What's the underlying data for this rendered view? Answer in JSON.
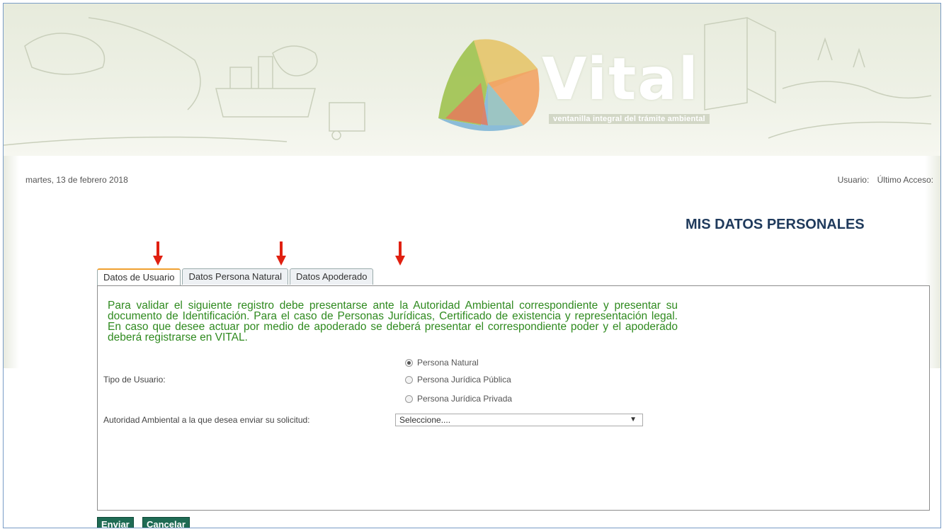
{
  "header": {
    "brand_name": "Vital",
    "brand_subtitle": "ventanilla integral del trámite ambiental"
  },
  "info": {
    "date": "martes, 13 de febrero 2018",
    "user_label": "Usuario:",
    "last_access_label": "Último Acceso:"
  },
  "page_title": "MIS DATOS PERSONALES",
  "tabs": [
    {
      "label": "Datos de Usuario",
      "active": true
    },
    {
      "label": "Datos Persona Natural",
      "active": false
    },
    {
      "label": "Datos Apoderado",
      "active": false
    }
  ],
  "form": {
    "notice": "Para validar el siguiente registro debe presentarse ante la Autoridad Ambiental correspondiente y presentar su documento de Identificación. Para el caso de Personas Jurídicas, Certificado de existencia y representación legal. En caso que desee actuar por medio de apoderado se deberá presentar el correspondiente poder y el apoderado deberá registrarse en VITAL.",
    "user_type_label": "Tipo de Usuario:",
    "user_type_options": [
      {
        "label": "Persona Natural",
        "selected": true
      },
      {
        "label": "Persona Jurídica Pública",
        "selected": false
      },
      {
        "label": "Persona Jurídica Privada",
        "selected": false
      }
    ],
    "authority_label": "Autoridad Ambiental a la que desea enviar su solicitud:",
    "authority_value": "Seleccione...."
  },
  "buttons": {
    "send": "Enviar",
    "cancel": "Cancelar"
  },
  "colors": {
    "title": "#1f3a5c",
    "notice": "#2f8a1f",
    "button": "#1f6b54",
    "arrow": "#e02010",
    "active_tab": "#f0a030"
  }
}
